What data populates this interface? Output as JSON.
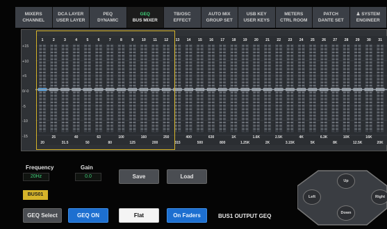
{
  "tabs": [
    {
      "line1": "MIXERS",
      "line2": "CHANNEL",
      "active": false
    },
    {
      "line1": "DCA LAYER",
      "line2": "USER LAYER",
      "active": false
    },
    {
      "line1": "PEQ",
      "line2": "DYNAMIC",
      "active": false
    },
    {
      "line1": "GEQ",
      "line2": "BUS MIXER",
      "active": true
    },
    {
      "line1": "TB/OSC",
      "line2": "EFFECT",
      "active": false
    },
    {
      "line1": "AUTO MIX",
      "line2": "GROUP SET",
      "active": false
    },
    {
      "line1": "USB KEY",
      "line2": "USER KEYS",
      "active": false
    },
    {
      "line1": "METERS",
      "line2": "CTRL ROOM",
      "active": false
    },
    {
      "line1": "PATCH",
      "line2": "DANTE SET",
      "active": false
    },
    {
      "line1": "♟ SYSTEM",
      "line2": "ENGINEER",
      "active": false
    }
  ],
  "geq": {
    "db_labels": [
      "+15",
      "+10",
      "+5",
      "0/-0",
      "-5",
      "-10",
      "-15"
    ],
    "band_numbers": [
      "1",
      "2",
      "3",
      "4",
      "5",
      "6",
      "7",
      "8",
      "9",
      "10",
      "11",
      "12",
      "13",
      "14",
      "15",
      "16",
      "17",
      "18",
      "19",
      "20",
      "21",
      "22",
      "23",
      "24",
      "25",
      "26",
      "27",
      "28",
      "29",
      "30",
      "31"
    ],
    "freq_top": [
      "25",
      "40",
      "63",
      "100",
      "160",
      "250",
      "400",
      "630",
      "1K",
      "1.6K",
      "2.5K",
      "4K",
      "6.3K",
      "10K",
      "16K"
    ],
    "freq_bottom": [
      "20",
      "31.5",
      "50",
      "80",
      "125",
      "200",
      "315",
      "500",
      "800",
      "1.25K",
      "2K",
      "3.15K",
      "5K",
      "8K",
      "12.5K",
      "20K"
    ],
    "selected_bands_label": "1-12"
  },
  "controls": {
    "frequency_label": "Frequency",
    "frequency_value": "20Hz",
    "gain_label": "Gain",
    "gain_value": "0.0",
    "save_label": "Save",
    "load_label": "Load",
    "bus_badge": "BUS01",
    "geq_select_label": "GEQ Select",
    "geq_on_label": "GEQ ON",
    "flat_label": "Flat",
    "on_faders_label": "On Faders",
    "output_label": "BUS1 OUTPUT GEQ"
  },
  "nav": {
    "up": "Up",
    "down": "Down",
    "left": "Left",
    "right": "Right"
  },
  "colors": {
    "active_tab_text": "#3fd27a",
    "selection_frame": "#d6b42a",
    "button_blue": "#1d6fd0",
    "gain_marker": "#2a8fe0"
  }
}
